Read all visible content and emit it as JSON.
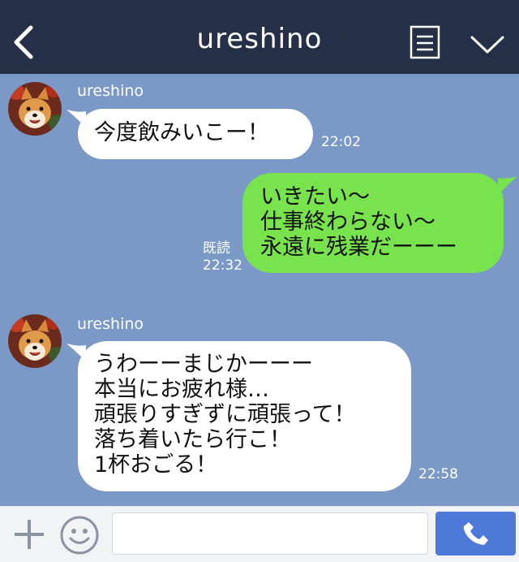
{
  "header": {
    "title": "ureshino",
    "back_icon": "chevron-left-icon",
    "notes_icon": "note-list-icon",
    "menu_icon": "chevron-down-icon",
    "background": "#262f48"
  },
  "chat": {
    "background": "#7a99c6",
    "messages": [
      {
        "direction": "incoming",
        "sender": "ureshino",
        "avatar": "shiba-dog-avatar",
        "text": "今度飲みいこー！",
        "time": "22:02"
      },
      {
        "direction": "outgoing",
        "text": "いきたい〜\n仕事終わらない〜\n永遠に残業だーーー",
        "read_label": "既読",
        "time": "22:32"
      },
      {
        "direction": "incoming",
        "sender": "ureshino",
        "avatar": "shiba-dog-avatar",
        "text": "うわーーまじかーーー\n本当にお疲れ様…\n頑張りすぎずに頑張って！\n落ち着いたら行こ！\n1杯おごる！",
        "time": "22:58"
      }
    ]
  },
  "footer": {
    "add_icon": "plus-icon",
    "sticker_icon": "smile-icon",
    "input_value": "",
    "call_icon": "phone-icon",
    "call_color": "#4d79d9"
  }
}
